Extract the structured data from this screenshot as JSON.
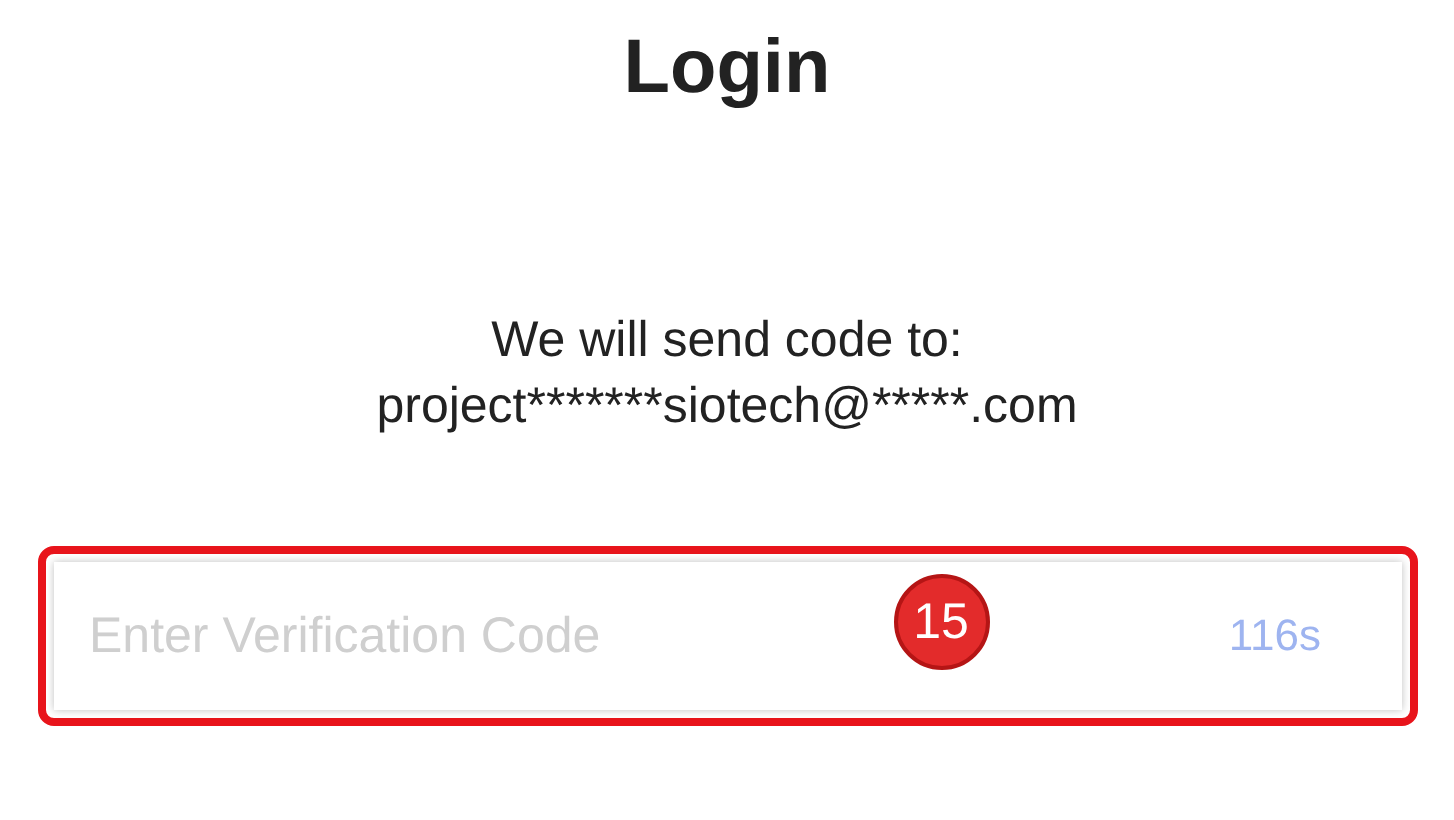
{
  "title": "Login",
  "message": [
    "We will send code to:",
    "project*******siotech@*****.com"
  ],
  "code_field": {
    "placeholder": "Enter Verification Code",
    "countdown": "116s"
  },
  "annotation": {
    "badge": "15"
  }
}
